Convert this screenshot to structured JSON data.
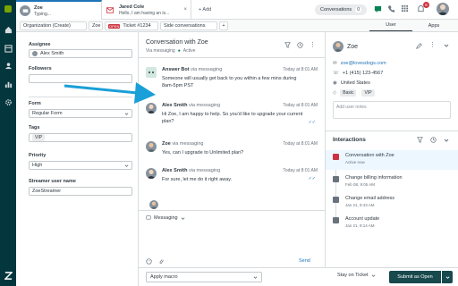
{
  "topbar": {
    "tabs": [
      {
        "name": "Zoe",
        "sub": "Typing..."
      },
      {
        "name": "Jared Cole",
        "sub": "Hello, I am having an is..."
      }
    ],
    "add_label": "+ Add",
    "conversations_label": "Conversations",
    "conversations_count": "0",
    "notifications_count": "8"
  },
  "subbar": {
    "crumbs": [
      "Organization (Create)",
      "Zoe"
    ],
    "ticket_status": "OPEN",
    "ticket_label": "Ticket #1234",
    "side_conversations": "Side conversations",
    "plus": "+",
    "user_tab": "User",
    "apps_tab": "Apps"
  },
  "left_panel": {
    "assignee_label": "Assignee",
    "assignee_value": "Alex Smith",
    "followers_label": "Followers",
    "form_label": "Form",
    "form_value": "Regular Form",
    "tags_label": "Tags",
    "tag_value": "VIP",
    "priority_label": "Priority",
    "priority_value": "High",
    "streamer_label": "Streamer user name",
    "streamer_value": "ZoeStreamer"
  },
  "conversation": {
    "title": "Conversation with Zoe",
    "via": "Via messaging",
    "status": "Active",
    "messages": [
      {
        "author": "Answer Bot",
        "via": "via messaging",
        "time": "Today at 8:01 AM",
        "text": "Someone will usually get back to you within a few mins during 8am-5pm PST"
      },
      {
        "author": "Alex Smith",
        "via": "via messaging",
        "time": "Today at 8:01 AM",
        "text": "Hi Zoe, I am happy to help. So you'd like to upgrade your current plan?"
      },
      {
        "author": "Zoe",
        "via": "via messaging",
        "time": "Today at 8:01 AM",
        "text": "Yes, can I upgrade to Unlimited plan?"
      },
      {
        "author": "Alex Smith",
        "via": "via messaging",
        "time": "Today at 8:01 AM",
        "text": "For sure, let me do it right away."
      }
    ],
    "composer_channel": "Messaging",
    "send_label": "Send"
  },
  "right_panel": {
    "name": "Zoe",
    "email": "zoe@lovesdogs.com",
    "phone": "+1 (415) 123-4567",
    "country": "United States",
    "tags": [
      "Basic",
      "VIP"
    ],
    "notes_placeholder": "Add user notes",
    "interactions_label": "Interactions",
    "interactions": [
      {
        "title": "Conversation with Zoe",
        "sub": "Active now",
        "color": "#cc3340"
      },
      {
        "title": "Change billing information",
        "sub": "Feb 08, 9:05 AM",
        "color": "#68737d"
      },
      {
        "title": "Change email address",
        "sub": "Jan 21, 9:43 AM",
        "color": "#68737d"
      },
      {
        "title": "Account update",
        "sub": "Jan 21, 9:14 AM",
        "color": "#68737d"
      }
    ]
  },
  "bottom": {
    "macro_label": "Apply macro",
    "stay_label": "Stay on Ticket",
    "submit_label": "Submit as Open"
  },
  "colors": {
    "nav": "#03363d",
    "accent": "#1f73b7",
    "submit": "#17494d",
    "arrow": "#1a9fd8"
  }
}
